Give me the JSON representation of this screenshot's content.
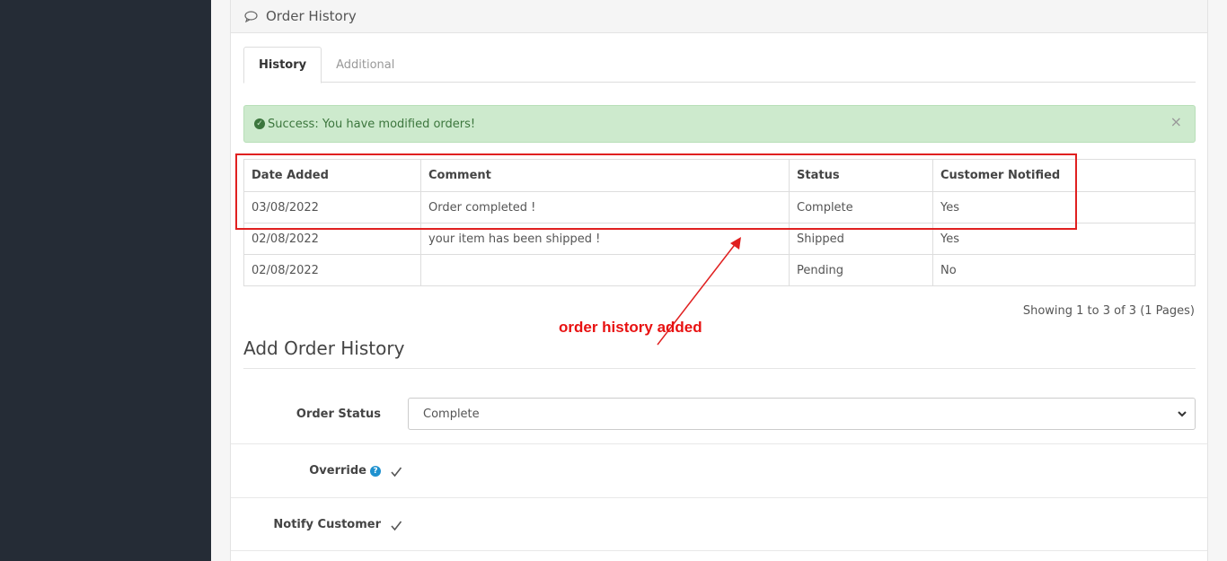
{
  "panel": {
    "title": "Order History",
    "icon": "comment-icon"
  },
  "tabs": [
    {
      "label": "History",
      "active": true
    },
    {
      "label": "Additional",
      "active": false
    }
  ],
  "alert": {
    "message": "Success: You have modified orders!",
    "close_label": "×"
  },
  "history_table": {
    "headers": [
      "Date Added",
      "Comment",
      "Status",
      "Customer Notified"
    ],
    "rows": [
      [
        "03/08/2022",
        "Order completed !",
        "Complete",
        "Yes"
      ],
      [
        "02/08/2022",
        "your item has been shipped !",
        "Shipped",
        "Yes"
      ],
      [
        "02/08/2022",
        "",
        "Pending",
        "No"
      ]
    ]
  },
  "pagination_info": "Showing 1 to 3 of 3 (1 Pages)",
  "annotation": {
    "text": "order history added",
    "color": "#e81111"
  },
  "add_history": {
    "title": "Add Order History",
    "order_status_label": "Order Status",
    "order_status_value": "Complete",
    "override_label": "Override",
    "override_help": "?",
    "override_checked": true,
    "notify_label": "Notify Customer",
    "notify_checked": true
  },
  "colors": {
    "sidebar": "#252c36",
    "alert_bg": "#cdeacd",
    "alert_text": "#3c763d",
    "help_icon": "#1e91cf"
  }
}
